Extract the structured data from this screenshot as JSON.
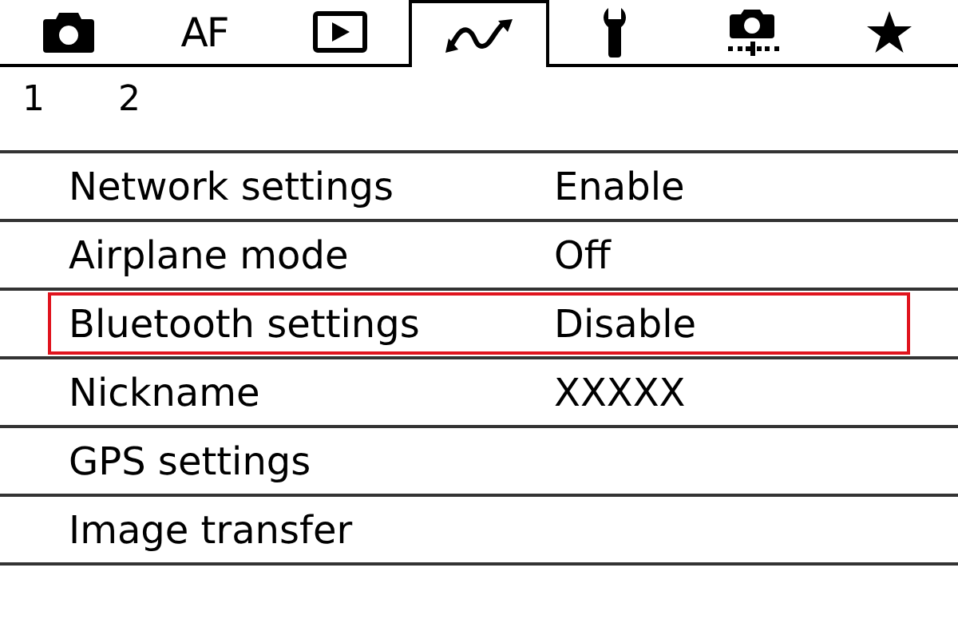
{
  "tabs": [
    {
      "kind": "icon",
      "selected": false
    },
    {
      "kind": "text",
      "label": "AF",
      "selected": false
    },
    {
      "kind": "icon",
      "selected": false
    },
    {
      "kind": "icon",
      "selected": true
    },
    {
      "kind": "icon",
      "selected": false
    },
    {
      "kind": "icon",
      "selected": false
    },
    {
      "kind": "icon",
      "selected": false
    }
  ],
  "pages": [
    "1",
    "2"
  ],
  "menu_items": [
    {
      "label": "Network settings",
      "value": "Enable",
      "selected": false
    },
    {
      "label": "Airplane mode",
      "value": "Off",
      "selected": false
    },
    {
      "label": "Bluetooth settings",
      "value": "Disable",
      "selected": true
    },
    {
      "label": "Nickname",
      "value": "XXXXX",
      "selected": false
    },
    {
      "label": "GPS settings",
      "selected": false
    },
    {
      "label": "Image transfer",
      "selected": false
    }
  ]
}
